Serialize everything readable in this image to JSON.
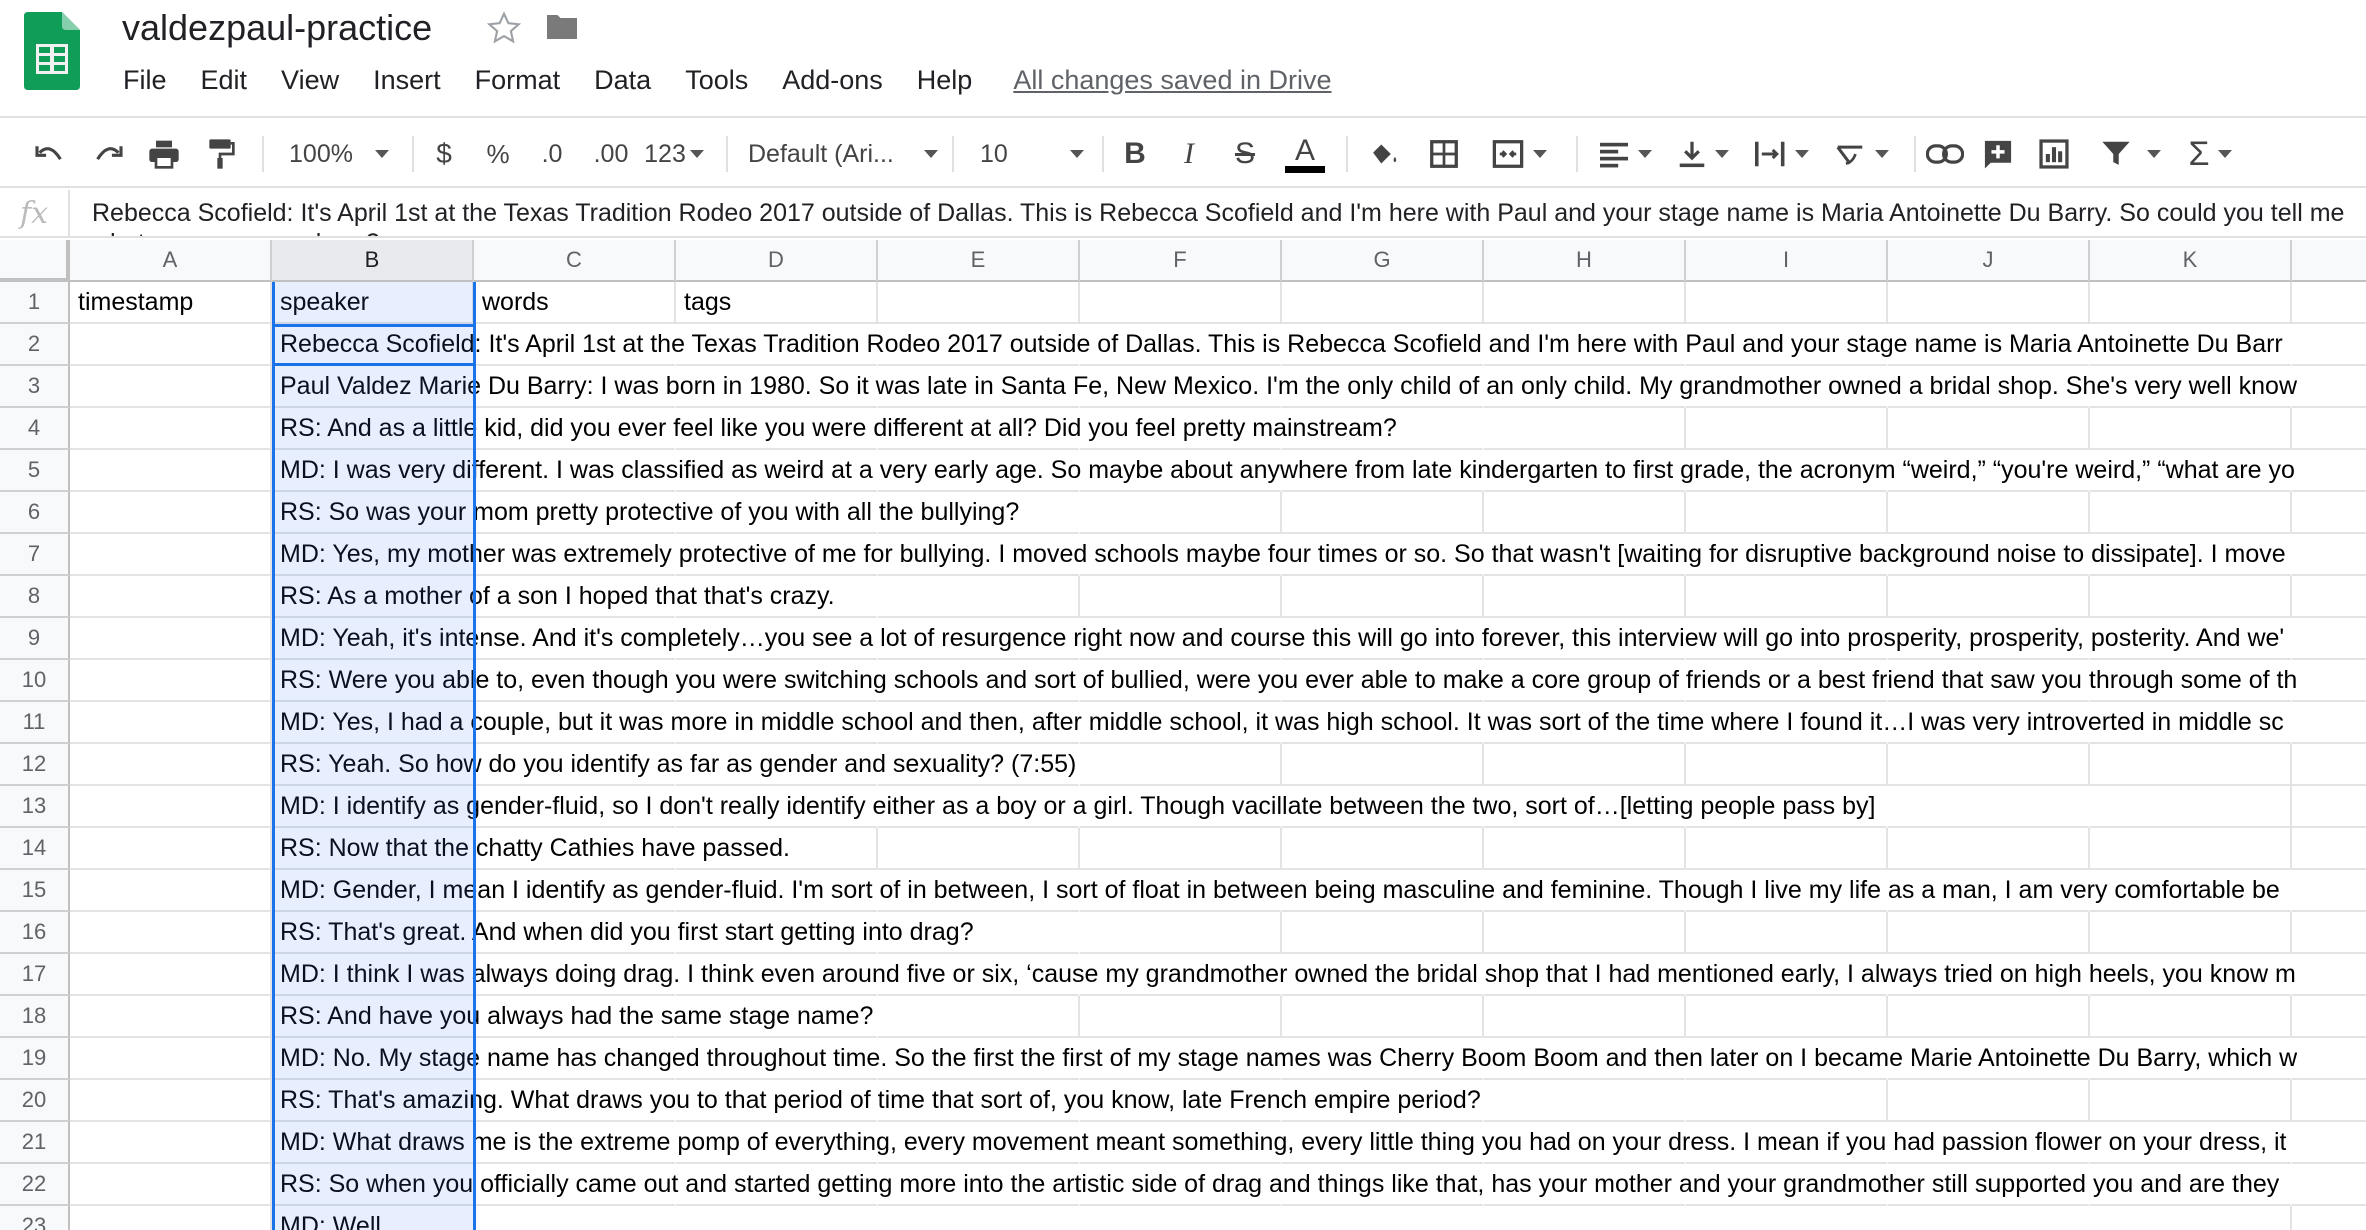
{
  "app": {
    "title": "valdezpaul-practice",
    "save_status": "All changes saved in Drive"
  },
  "menu": [
    "File",
    "Edit",
    "View",
    "Insert",
    "Format",
    "Data",
    "Tools",
    "Add-ons",
    "Help"
  ],
  "toolbar": {
    "zoom": "100%",
    "currency": "$",
    "percent": "%",
    "decrease_decimal": ".0",
    "increase_decimal": ".00",
    "more_formats": "123",
    "font": "Default (Ari...",
    "font_size": "10",
    "bold": "B",
    "italic": "I",
    "strikethrough": "S",
    "text_color": "A"
  },
  "formula_bar": {
    "fx": "fx",
    "value": "Rebecca Scofield: It's April 1st at the Texas Tradition Rodeo 2017 outside of Dallas. This is Rebecca Scofield and I'm here with Paul and your stage name is Maria Antoinette Du Barry. So could you tell me what year you were born?"
  },
  "columns": [
    "A",
    "B",
    "C",
    "D",
    "E",
    "F",
    "G",
    "H",
    "I",
    "J",
    "K"
  ],
  "selected_column": "B",
  "header_row": [
    "timestamp",
    "speaker",
    "words",
    "tags"
  ],
  "rows": [
    {
      "num": "1",
      "a": "timestamp",
      "b": "speaker",
      "c": "words",
      "d": "tags"
    },
    {
      "num": "2",
      "b": "Rebecca Scofield: It's April 1st at the Texas Tradition Rodeo 2017 outside of Dallas. This is Rebecca Scofield and I'm here with Paul and your stage name is Maria Antoinette Du Barr"
    },
    {
      "num": "3",
      "b": "Paul Valdez Marie Du Barry: I was born in 1980. So it was late in Santa Fe, New Mexico. I'm the only child of an only child. My grandmother owned a bridal shop. She's very well know"
    },
    {
      "num": "4",
      "b": "RS: And as a little kid, did you ever feel like you were different at all? Did you feel pretty mainstream?"
    },
    {
      "num": "5",
      "b": "MD: I was very different. I was classified as weird at a very early age. So maybe about anywhere from late kindergarten to first grade, the acronym “weird,” “you're weird,” “what are yo"
    },
    {
      "num": "6",
      "b": "RS: So was your mom pretty protective of you with all the bullying?"
    },
    {
      "num": "7",
      "b": "MD: Yes, my mother was extremely protective of me for bullying. I moved schools maybe four times or so. So that wasn't [waiting for disruptive background noise to dissipate]. I move"
    },
    {
      "num": "8",
      "b": "RS: As a mother of a son I hoped that that's crazy."
    },
    {
      "num": "9",
      "b": "MD: Yeah, it's intense. And it's completely…you see a lot of resurgence right now and course this will go into forever, this interview will go into prosperity, prosperity, posterity. And we'"
    },
    {
      "num": "10",
      "b": "RS: Were you able to, even though you were switching schools and sort of bullied, were you ever able to make a core group of friends or a best friend that saw you through some of th"
    },
    {
      "num": "11",
      "b": "MD: Yes, I had a couple, but it was more in middle school and then, after middle school, it was high school. It was sort of the time where I found it…I was very introverted in middle sc"
    },
    {
      "num": "12",
      "b": "RS: Yeah. So how do you identify as far as gender and sexuality? (7:55)"
    },
    {
      "num": "13",
      "b": "MD: I identify as gender-fluid, so I don't really identify either as a boy or a girl. Though vacillate between the two, sort of…[letting people pass by]"
    },
    {
      "num": "14",
      "b": "RS: Now that the chatty Cathies have passed."
    },
    {
      "num": "15",
      "b": "MD:  Gender, I mean I identify as gender-fluid. I'm sort of in between, I sort of float in between being masculine and feminine. Though I live my life as a man, I am very comfortable be"
    },
    {
      "num": "16",
      "b": "RS: That's great. And when did you first start getting into drag?"
    },
    {
      "num": "17",
      "b": "MD: I think I was always doing drag. I think even around five or six, ‘cause my grandmother owned the bridal shop that I had mentioned early, I always tried on high heels, you know m"
    },
    {
      "num": "18",
      "b": "RS: And have you always had the same stage name?"
    },
    {
      "num": "19",
      "b": "MD: No. My stage name has changed throughout time. So the first the first of my stage names was Cherry Boom Boom and then later on I became Marie Antoinette Du Barry, which w"
    },
    {
      "num": "20",
      "b": "RS: That's amazing. What draws you to that period of time that sort of, you know, late French empire period?"
    },
    {
      "num": "21",
      "b": "MD: What draws me is the extreme pomp of everything, every movement meant something, every little thing you had on your dress. I mean if you had passion flower on your dress, it"
    },
    {
      "num": "22",
      "b": "RS: So when you officially came out and started getting more into the artistic side of drag and things like that, has your mother and your grandmother still supported you and are they"
    },
    {
      "num": "23",
      "b": "MD: Well,                                                                                                                                          "
    }
  ],
  "colors": {
    "sheets_green": "#0f9d58",
    "selection_blue": "#1a73e8",
    "header_bg": "#f8f9fa",
    "grid_line": "#e2e3e3"
  }
}
